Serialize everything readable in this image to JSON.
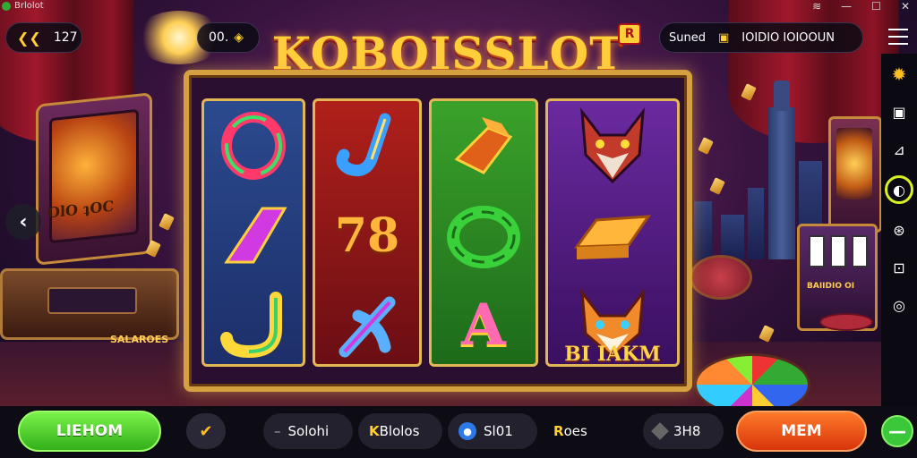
{
  "window": {
    "title": "Brlolot",
    "controls": [
      "wifi-icon",
      "minimize-icon",
      "maximize-icon",
      "close-icon"
    ]
  },
  "header": {
    "back_value": "127",
    "coins_value": "00.",
    "logo_text": "KOBOISSLOT",
    "logo_badge": "R",
    "saved_label": "Suned",
    "saved_value": "IOIDIO IOIOOUN"
  },
  "scene": {
    "left_cabinet_text": "OlO ʇOC",
    "left_console_label": "SALAROES",
    "right_slot_label": "BAIIDIO OI",
    "bonus_text": "BI IAKM"
  },
  "reels": [
    {
      "name": "reel-blue",
      "color": "#2b4a8e",
      "symbols": [
        "O-glyph",
        "slash-glyph",
        "J-glyph"
      ]
    },
    {
      "name": "reel-red",
      "color": "#b0201a",
      "symbols": [
        "J-glyph",
        "78-glyph",
        "K-glyph"
      ]
    },
    {
      "name": "reel-green",
      "color": "#3aa22a",
      "symbols": [
        "gold-bar",
        "green-coil",
        "A-glyph"
      ]
    },
    {
      "name": "reel-purple",
      "color": "#6a2aa0",
      "symbols": [
        "wolf-head",
        "gold-bar",
        "fox-head"
      ]
    }
  ],
  "reel_text": {
    "r2_mid": "78",
    "r3_bottom": "A"
  },
  "sidebar": {
    "icons": [
      "menu-icon",
      "gear-icon",
      "screen-icon",
      "cast-icon",
      "record-icon",
      "settings-dial-icon",
      "scan-icon",
      "target-icon"
    ]
  },
  "bottom": {
    "play_label": "LIEHOM",
    "pill1": "Solohi",
    "pill2_prefix": "K",
    "pill2": "Blolos",
    "pill3": "Sl01",
    "pill4_prefix": "R",
    "pill4": "oes",
    "pill5": "3H8",
    "action_label": "MEM",
    "minus_label": "—"
  },
  "colors": {
    "accent_gold": "#ffcf3a",
    "green": "#33b01a",
    "orange": "#d8340a"
  }
}
